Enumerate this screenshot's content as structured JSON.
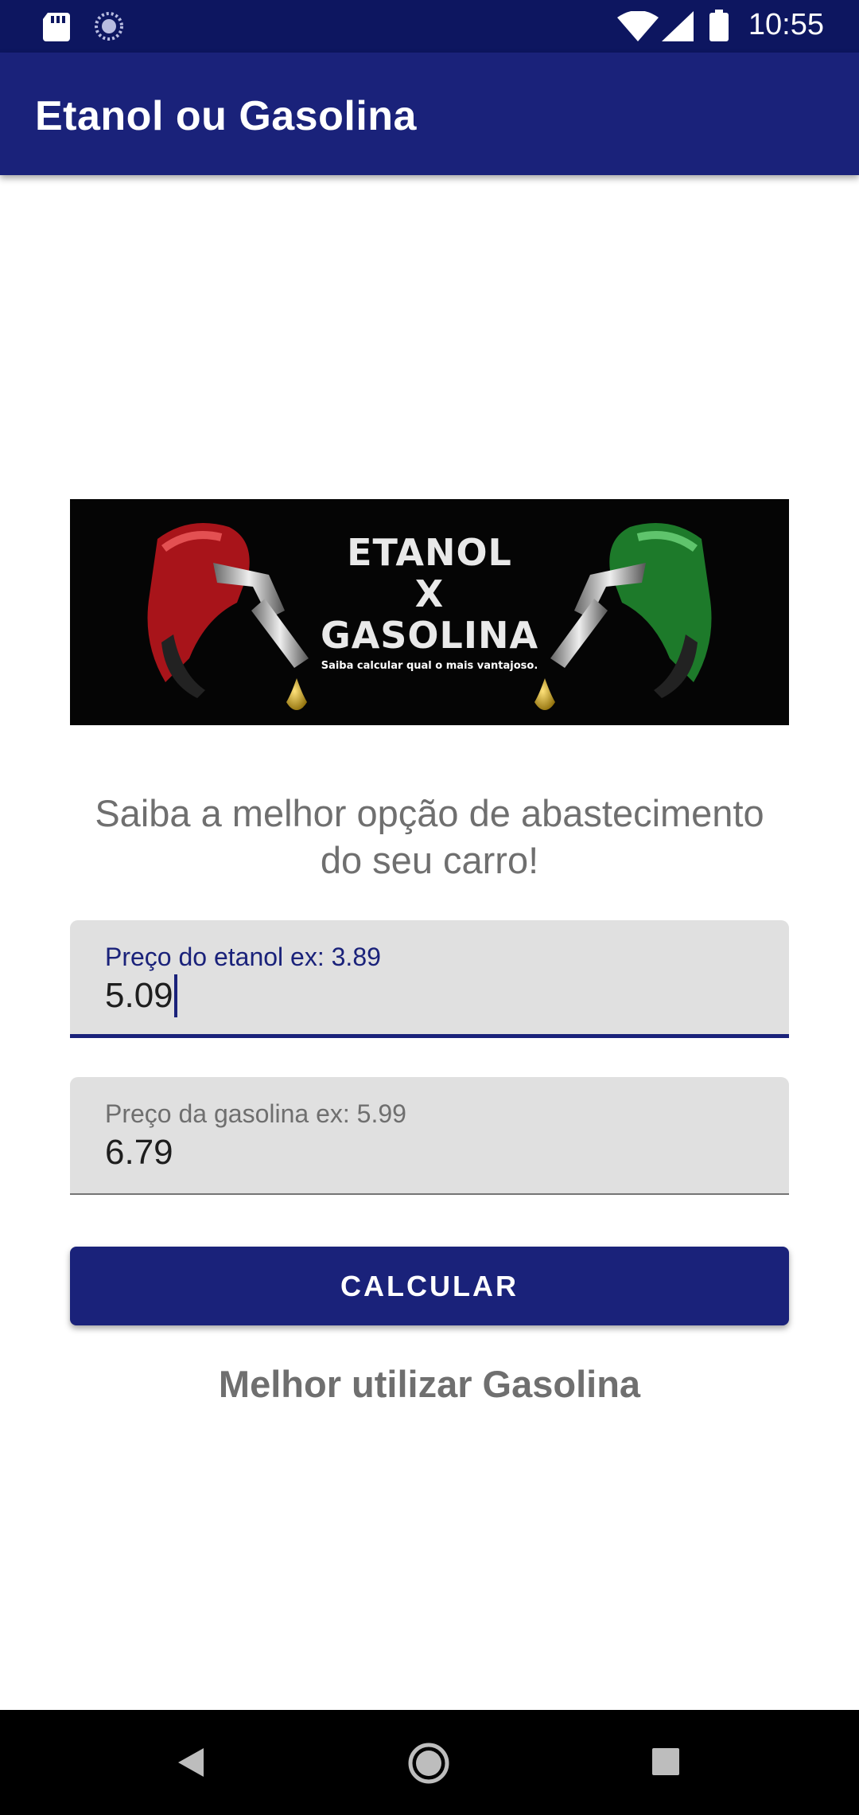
{
  "status_bar": {
    "time": "10:55",
    "icons": [
      "sd-card-icon",
      "sync-icon",
      "wifi-icon",
      "signal-icon",
      "battery-icon"
    ]
  },
  "app_bar": {
    "title": "Etanol ou Gasolina",
    "color": "#1a227a"
  },
  "banner": {
    "line1": "ETANOL",
    "line2": "X",
    "line3": "GASOLINA",
    "sub": "Saiba calcular qual o mais vantajoso."
  },
  "subtitle": "Saiba a melhor opção de abastecimento do seu carro!",
  "etanol_field": {
    "label": "Preço do etanol ex: 3.89",
    "value": "5.09"
  },
  "gasolina_field": {
    "label": "Preço da gasolina ex: 5.99",
    "value": "6.79"
  },
  "calc_button": {
    "label": "CALCULAR"
  },
  "result": "Melhor utilizar Gasolina",
  "nav_bar": {
    "icons": [
      "back-icon",
      "home-icon",
      "recents-icon"
    ]
  }
}
